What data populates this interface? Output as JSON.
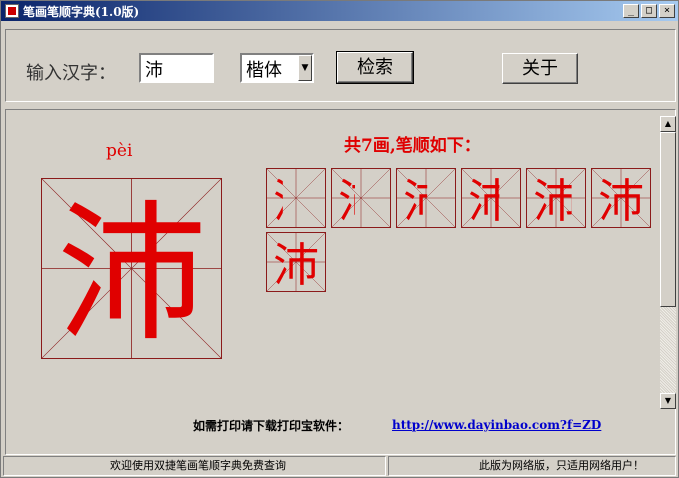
{
  "window": {
    "title": "笔画笔顺字典(1.0版)",
    "controls": {
      "minimize": "_",
      "maximize": "□",
      "close": "×"
    }
  },
  "toolbar": {
    "input_label": "输入汉字：",
    "input_value": "沛",
    "font_value": "楷体",
    "search_label": "检索",
    "about_label": "关于"
  },
  "result": {
    "pinyin": "pèi",
    "character": "沛",
    "stroke_summary": "共7画,笔顺如下：",
    "stroke_count": 7
  },
  "footer": {
    "print_note": "如需打印请下载打印宝软件：",
    "print_link": "http://www.dayinbao.com?f=ZD"
  },
  "status": {
    "left": "欢迎使用双捷笔画笔顺字典免费查询",
    "right": "此版为网络版，只适用网络用户！"
  },
  "colors": {
    "grid": "#8b1a1a",
    "ink": "#e00000",
    "current_stroke": "#8b0000"
  }
}
